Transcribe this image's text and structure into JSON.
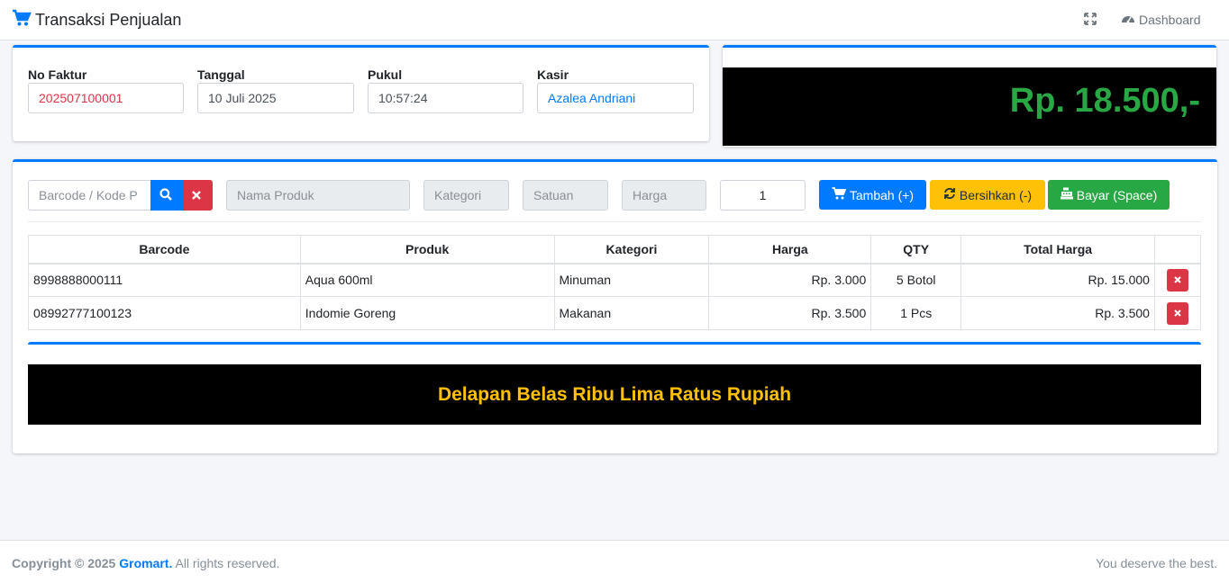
{
  "header": {
    "title": "Transaksi Penjualan",
    "dashboard_label": "Dashboard"
  },
  "info": {
    "no_faktur_label": "No Faktur",
    "no_faktur_value": "202507100001",
    "tanggal_label": "Tanggal",
    "tanggal_value": "10 Juli 2025",
    "pukul_label": "Pukul",
    "pukul_value": "10:57:24",
    "kasir_label": "Kasir",
    "kasir_value": "Azalea Andriani"
  },
  "total": {
    "display": "Rp. 18.500,-"
  },
  "entry": {
    "barcode_placeholder": "Barcode / Kode P",
    "nama_placeholder": "Nama Produk",
    "kategori_placeholder": "Kategori",
    "satuan_placeholder": "Satuan",
    "harga_placeholder": "Harga",
    "qty_value": "1",
    "tambah_label": "Tambah (+)",
    "bersihkan_label": "Bersihkan (-)",
    "bayar_label": "Bayar (Space)"
  },
  "table": {
    "headers": [
      "Barcode",
      "Produk",
      "Kategori",
      "Harga",
      "QTY",
      "Total Harga"
    ],
    "rows": [
      {
        "barcode": "8998888000111",
        "produk": "Aqua 600ml",
        "kategori": "Minuman",
        "harga": "Rp. 3.000",
        "qty": "5 Botol",
        "total": "Rp. 15.000"
      },
      {
        "barcode": "08992777100123",
        "produk": "Indomie Goreng",
        "kategori": "Makanan",
        "harga": "Rp. 3.500",
        "qty": "1 Pcs",
        "total": "Rp. 3.500"
      }
    ]
  },
  "terbilang": "Delapan Belas Ribu Lima Ratus Rupiah",
  "footer": {
    "copyright_prefix": "Copyright © 2025",
    "brand": "Gromart.",
    "suffix": "All rights reserved.",
    "right": "You deserve the best."
  },
  "colors": {
    "primary": "#007bff",
    "danger": "#dc3545",
    "warning": "#ffc107",
    "success": "#28a745"
  }
}
